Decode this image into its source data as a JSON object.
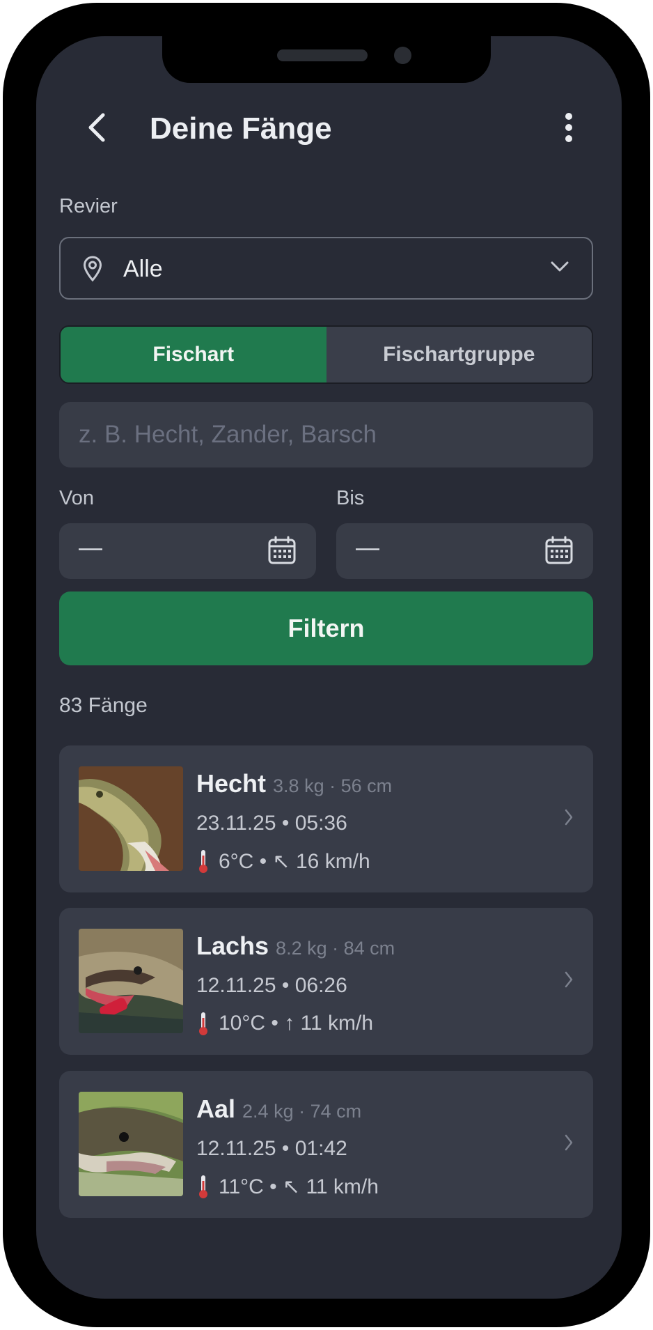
{
  "header": {
    "title": "Deine Fänge"
  },
  "filters": {
    "revier_label": "Revier",
    "revier_value": "Alle",
    "segments": [
      {
        "label": "Fischart",
        "active": true
      },
      {
        "label": "Fischartgruppe",
        "active": false
      }
    ],
    "search_placeholder": "z. B. Hecht, Zander, Barsch",
    "von_label": "Von",
    "von_value": "—",
    "bis_label": "Bis",
    "bis_value": "—",
    "filter_button": "Filtern"
  },
  "results": {
    "count_label": "83 Fänge",
    "catches": [
      {
        "species": "Hecht",
        "details": "3.8 kg · 56 cm",
        "datetime": "23.11.25 • 05:36",
        "weather": "6°C • ↖ 16 km/h"
      },
      {
        "species": "Lachs",
        "details": "8.2 kg · 84 cm",
        "datetime": "12.11.25 • 06:26",
        "weather": "10°C • ↑ 11 km/h"
      },
      {
        "species": "Aal",
        "details": "2.4 kg · 74 cm",
        "datetime": "12.11.25 • 01:42",
        "weather": "11°C • ↖ 11 km/h"
      }
    ]
  },
  "colors": {
    "accent": "#207a4e",
    "background": "#282b36",
    "card": "#383c48"
  },
  "icons": [
    "back-arrow-icon",
    "more-vertical-icon",
    "location-pin-icon",
    "chevron-down-icon",
    "calendar-icon",
    "thermometer-icon",
    "chevron-right-icon"
  ]
}
